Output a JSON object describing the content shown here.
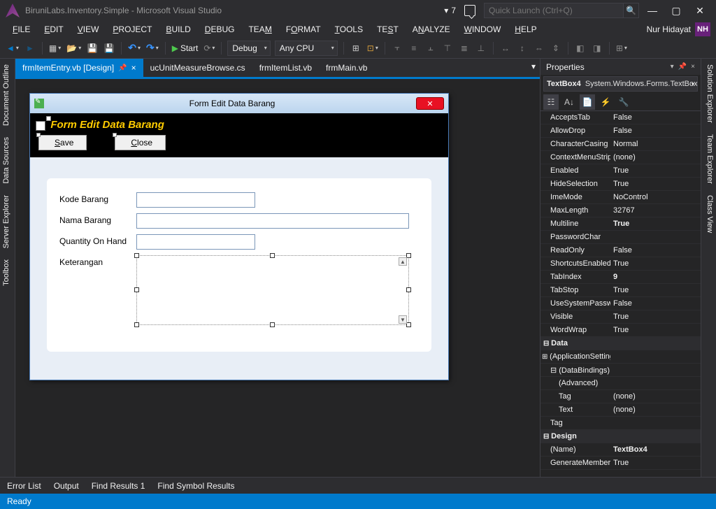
{
  "title": "BiruniLabs.Inventory.Simple - Microsoft Visual Studio",
  "notif_count": "7",
  "quick_launch_placeholder": "Quick Launch (Ctrl+Q)",
  "user_name": "Nur Hidayat",
  "user_initials": "NH",
  "menu": [
    "FILE",
    "EDIT",
    "VIEW",
    "PROJECT",
    "BUILD",
    "DEBUG",
    "TEAM",
    "FORMAT",
    "TOOLS",
    "TEST",
    "ANALYZE",
    "WINDOW",
    "HELP"
  ],
  "toolbar": {
    "start": "Start",
    "config": "Debug",
    "platform": "Any CPU"
  },
  "doc_tabs": [
    {
      "label": "frmItemEntry.vb [Design]",
      "active": true
    },
    {
      "label": "ucUnitMeasureBrowse.cs",
      "active": false
    },
    {
      "label": "frmItemList.vb",
      "active": false
    },
    {
      "label": "frmMain.vb",
      "active": false
    }
  ],
  "left_rail": [
    "Document Outline",
    "Data Sources",
    "Server Explorer",
    "Toolbox"
  ],
  "right_rail": [
    "Solution Explorer",
    "Team Explorer",
    "Class View"
  ],
  "form": {
    "window_title": "Form Edit Data Barang",
    "panel_title": "Form Edit Data Barang",
    "save": "Save",
    "close": "Close",
    "lbl_kode": "Kode Barang",
    "lbl_nama": "Nama Barang",
    "lbl_qty": "Quantity On Hand",
    "lbl_ket": "Keterangan"
  },
  "props": {
    "title": "Properties",
    "selected": "TextBox4",
    "selected_type": "System.Windows.Forms.TextBox",
    "rows": [
      {
        "name": "AcceptsTab",
        "val": "False"
      },
      {
        "name": "AllowDrop",
        "val": "False"
      },
      {
        "name": "CharacterCasing",
        "val": "Normal"
      },
      {
        "name": "ContextMenuStrip",
        "val": "(none)"
      },
      {
        "name": "Enabled",
        "val": "True"
      },
      {
        "name": "HideSelection",
        "val": "True"
      },
      {
        "name": "ImeMode",
        "val": "NoControl"
      },
      {
        "name": "MaxLength",
        "val": "32767"
      },
      {
        "name": "Multiline",
        "val": "True",
        "bold": true
      },
      {
        "name": "PasswordChar",
        "val": ""
      },
      {
        "name": "ReadOnly",
        "val": "False"
      },
      {
        "name": "ShortcutsEnabled",
        "val": "True"
      },
      {
        "name": "TabIndex",
        "val": "9",
        "bold": true
      },
      {
        "name": "TabStop",
        "val": "True"
      },
      {
        "name": "UseSystemPasswordChar",
        "val": "False"
      },
      {
        "name": "Visible",
        "val": "True"
      },
      {
        "name": "WordWrap",
        "val": "True"
      }
    ],
    "cat_data": "Data",
    "app_settings": "(ApplicationSettings)",
    "data_bindings": "(DataBindings)",
    "advanced": "(Advanced)",
    "tag_sub": "Tag",
    "tag_sub_val": "(none)",
    "text_sub": "Text",
    "text_sub_val": "(none)",
    "tag": "Tag",
    "cat_design": "Design",
    "name_prop": "(Name)",
    "name_val": "TextBox4",
    "gen": "GenerateMember",
    "gen_val": "True"
  },
  "bottom_tabs": [
    "Error List",
    "Output",
    "Find Results 1",
    "Find Symbol Results"
  ],
  "status": "Ready"
}
